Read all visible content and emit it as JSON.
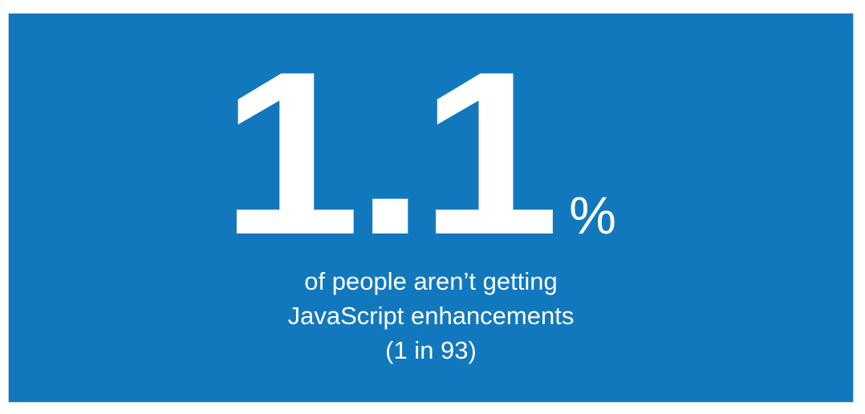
{
  "stat": {
    "number": "1.1",
    "unit": "%"
  },
  "caption": {
    "line1": "of people aren’t getting",
    "line2": "JavaScript enhancements",
    "line3": "(1 in 93)"
  },
  "colors": {
    "panel_background": "#1278be",
    "text": "#ffffff"
  }
}
